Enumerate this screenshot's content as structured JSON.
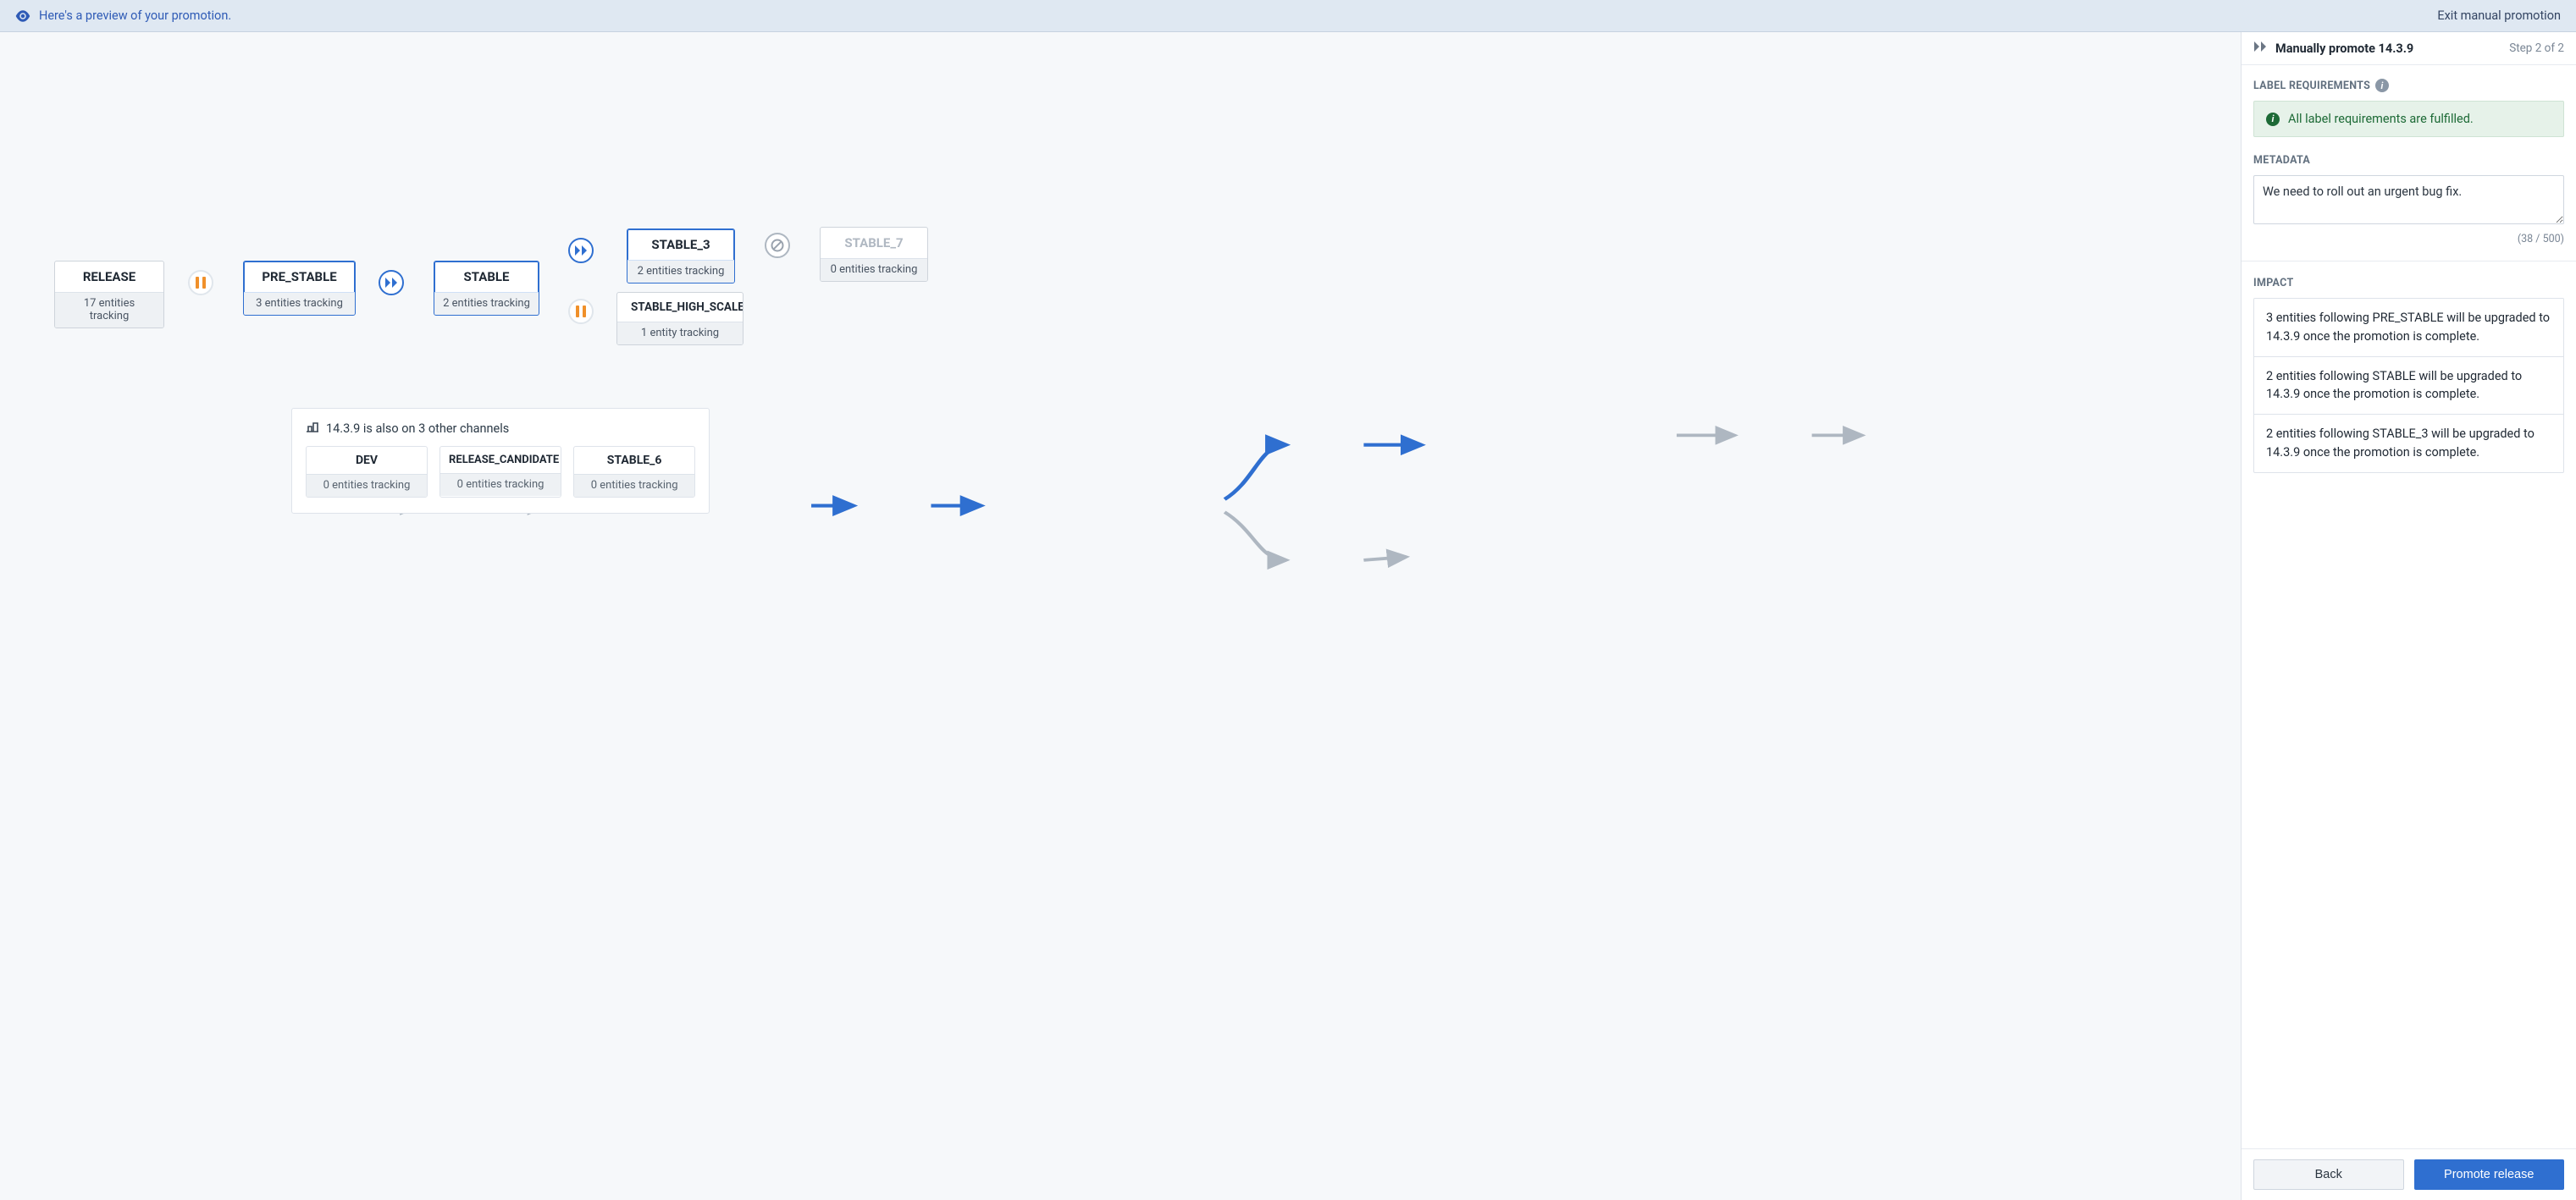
{
  "banner": {
    "preview_text": "Here's a preview of your promotion.",
    "exit_text": "Exit manual promotion"
  },
  "side": {
    "title": "Manually promote 14.3.9",
    "step_text": "Step 2 of 2",
    "label_requirements_heading": "LABEL REQUIREMENTS",
    "label_requirements_ok": "All label requirements are fulfilled.",
    "metadata_heading": "METADATA",
    "metadata_value": "We need to roll out an urgent bug fix.",
    "metadata_counter": "(38 / 500)",
    "impact_heading": "IMPACT",
    "impact_items": [
      "3 entities following PRE_STABLE will be upgraded to 14.3.9 once the promotion is complete.",
      "2 entities following STABLE will be upgraded to 14.3.9 once the promotion is complete.",
      "2 entities following STABLE_3 will be upgraded to 14.3.9 once the promotion is complete."
    ],
    "back_label": "Back",
    "promote_label": "Promote release"
  },
  "flow": {
    "nodes": {
      "release": {
        "name": "RELEASE",
        "sub": "17 entities tracking"
      },
      "pre_stable": {
        "name": "PRE_STABLE",
        "sub": "3 entities tracking"
      },
      "stable": {
        "name": "STABLE",
        "sub": "2 entities tracking"
      },
      "stable_3": {
        "name": "STABLE_3",
        "sub": "2 entities tracking"
      },
      "stable_high_scale": {
        "name": "STABLE_HIGH_SCALE",
        "sub": "1 entity tracking"
      },
      "stable_7": {
        "name": "STABLE_7",
        "sub": "0 entities tracking"
      }
    }
  },
  "other_channels": {
    "heading": "14.3.9 is also on 3 other channels",
    "items": [
      {
        "name": "DEV",
        "sub": "0 entities tracking"
      },
      {
        "name": "RELEASE_CANDIDATE",
        "sub": "0 entities tracking"
      },
      {
        "name": "STABLE_6",
        "sub": "0 entities tracking"
      }
    ]
  },
  "colors": {
    "accent_blue": "#2f6fd0",
    "pause_orange": "#f0902a",
    "ok_green": "#1d6a36"
  }
}
